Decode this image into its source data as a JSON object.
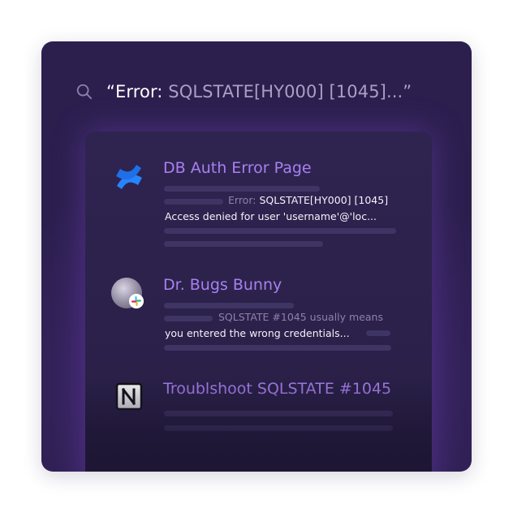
{
  "search": {
    "icon": "search-icon",
    "query_open_quote": "“",
    "query_strong": "Error:",
    "query_rest": " SQLSTATE[HY000] [1045]...”"
  },
  "results": [
    {
      "icon": "confluence-icon",
      "title": "DB Auth Error Page",
      "snippet_line1_muted": "Error:",
      "snippet_line1_bright": " SQLSTATE[HY000] [1045]",
      "snippet_line2": "Access denied for user 'username'@'loc..."
    },
    {
      "icon": "slack-avatar-icon",
      "title": "Dr. Bugs Bunny",
      "snippet_line1": "SQLSTATE #1045 usually means",
      "snippet_line2": "you entered the wrong credentials..."
    },
    {
      "icon": "notion-icon",
      "title": "Troublshoot SQLSTATE #1045"
    }
  ],
  "colors": {
    "card_bg": "#2c1f4e",
    "panel_bg": "#2f2450",
    "accent_title": "#a780f0",
    "confluence_blue": "#2684ff",
    "skeleton": "#3f3565"
  }
}
